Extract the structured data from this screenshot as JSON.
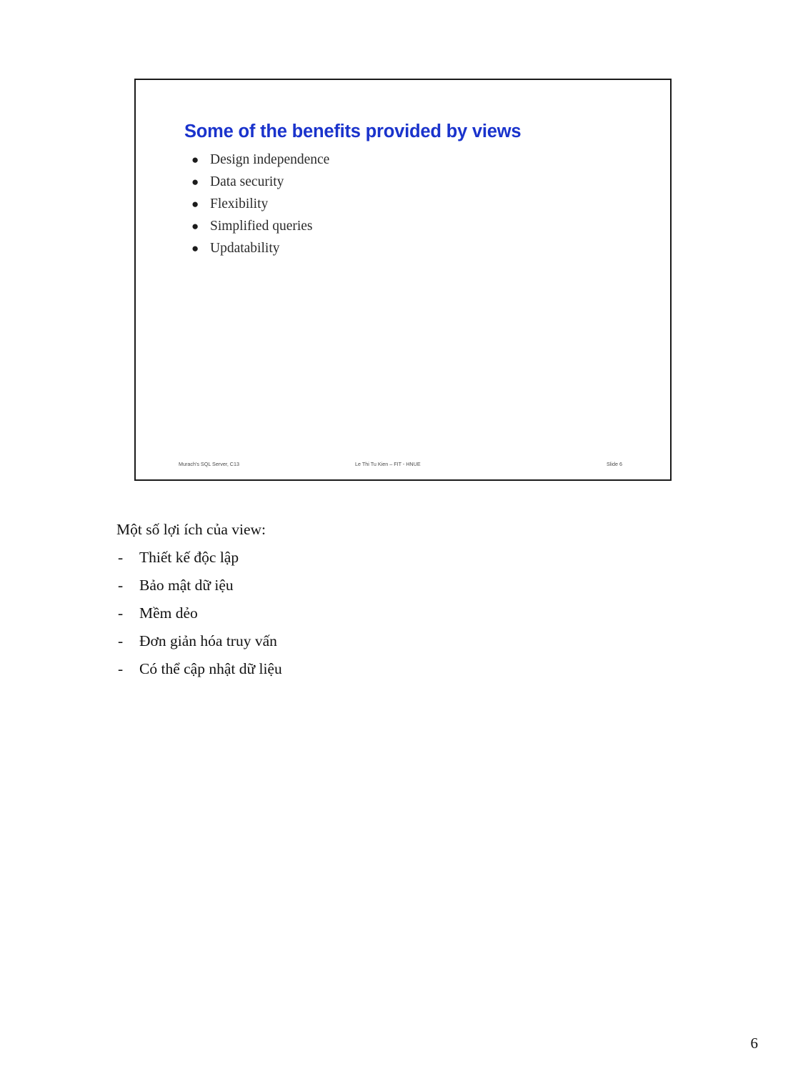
{
  "page": {
    "number": "6"
  },
  "slide": {
    "title": "Some of the benefits provided by views",
    "bullet_marker": "●",
    "bullets": [
      {
        "label": "Design independence"
      },
      {
        "label": "Data security"
      },
      {
        "label": "Flexibility"
      },
      {
        "label": "Simplified queries"
      },
      {
        "label": "Updatability"
      }
    ],
    "footer": {
      "left": "Murach's SQL Server, C13",
      "center": "Le Thi Tu Kien – FIT - HNUE",
      "right": "Slide 6"
    },
    "title_color": "#1a33cc",
    "border_color": "#1a1a1a"
  },
  "body": {
    "intro": "Một số lợi ích của view:",
    "dash_marker": "-",
    "items": [
      {
        "label": "Thiết kế độc lập"
      },
      {
        "label": "Bảo mật dữ iệu"
      },
      {
        "label": "Mềm dẻo"
      },
      {
        "label": "Đơn giản hóa truy vấn"
      },
      {
        "label": "Có thể cập nhật dữ liệu"
      }
    ]
  }
}
